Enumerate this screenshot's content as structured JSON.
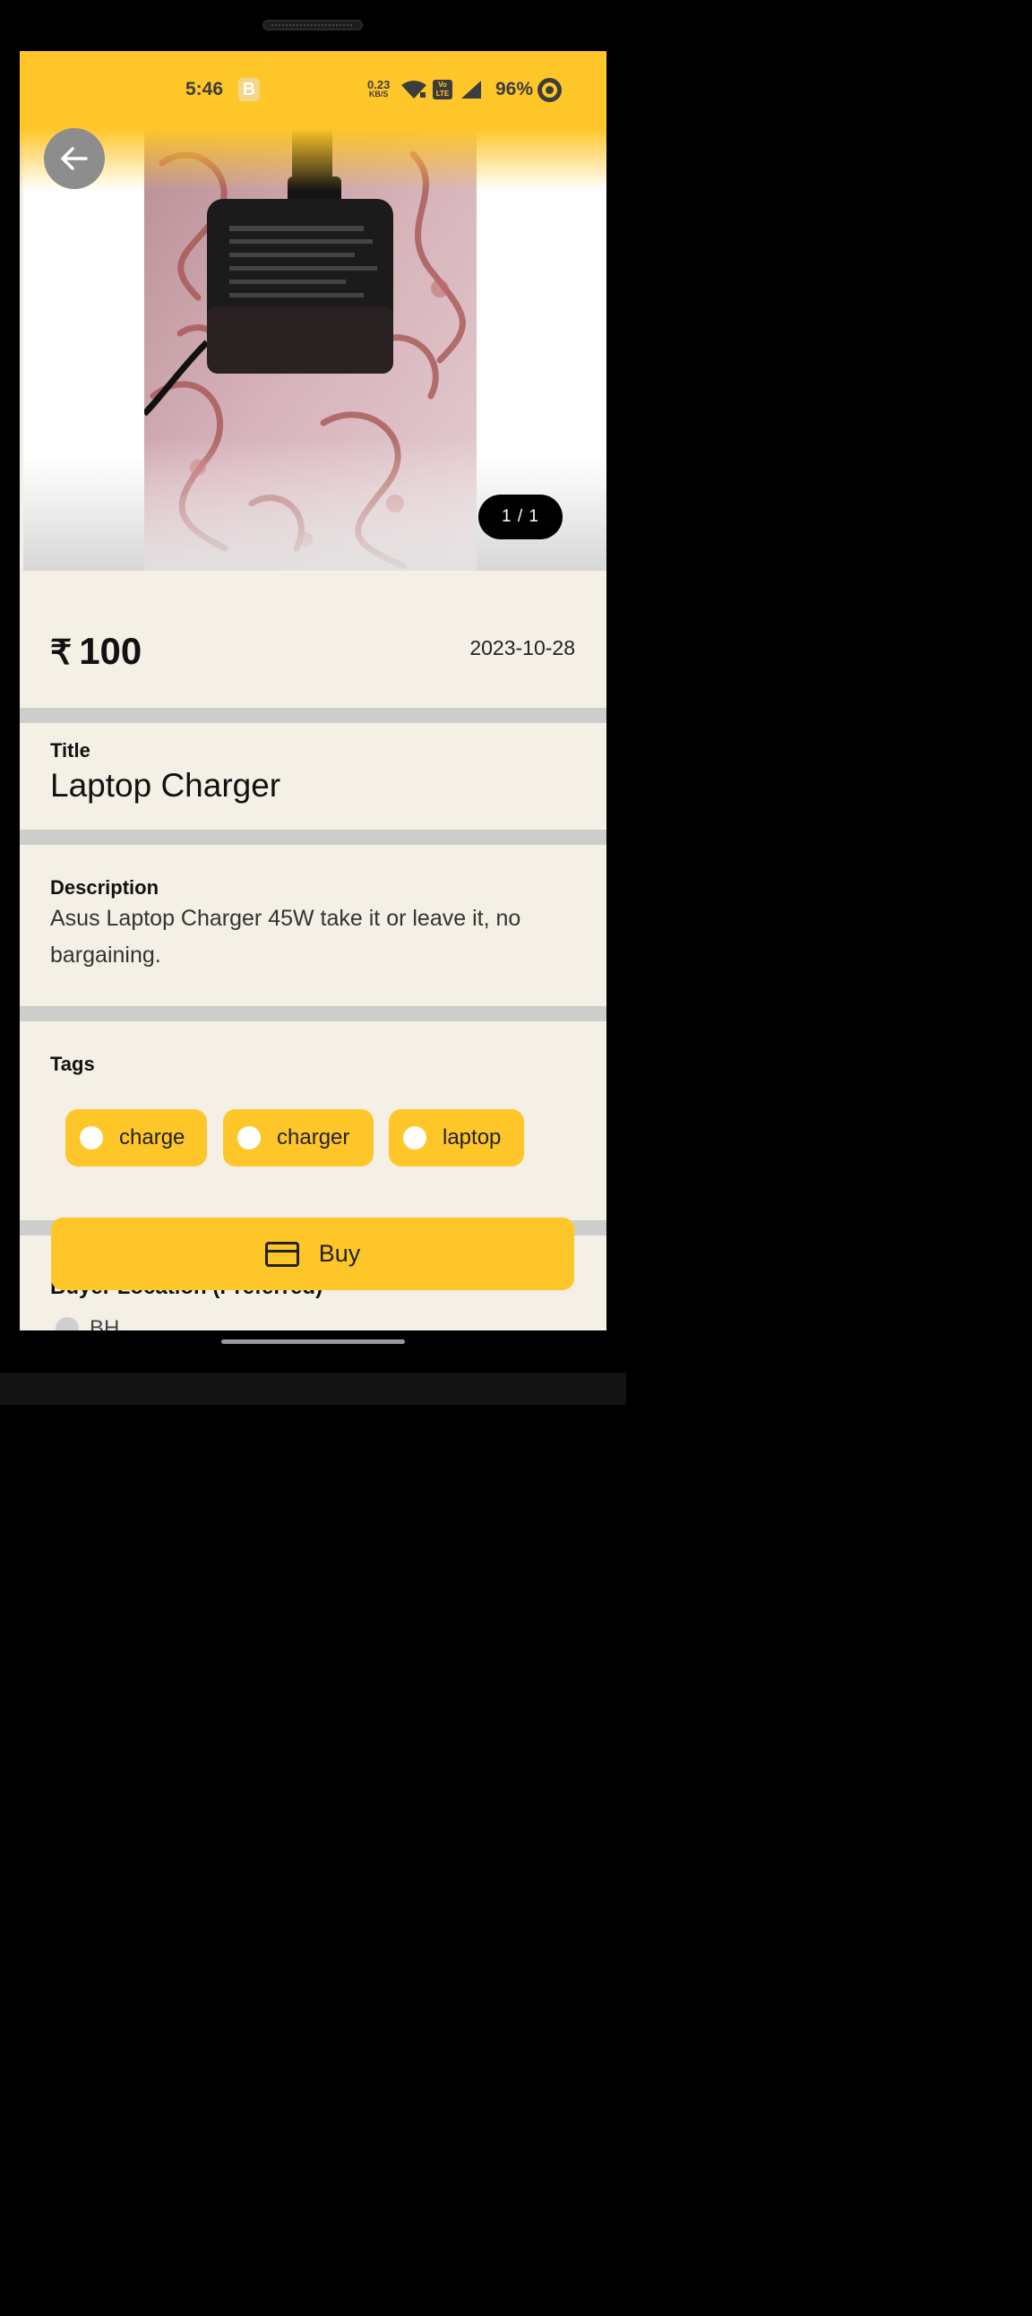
{
  "status_bar": {
    "time": "5:46",
    "app_badge": "B",
    "speed_value": "0.23",
    "speed_unit": "KB/S",
    "volte_top": "Vo",
    "volte_bottom": "LTE",
    "battery": "96%"
  },
  "gallery": {
    "counter": "1 / 1"
  },
  "listing": {
    "currency_symbol": "₹",
    "price": "100",
    "date": "2023-10-28",
    "title_label": "Title",
    "title": "Laptop Charger",
    "description_label": "Description",
    "description": "Asus Laptop Charger 45W take it or leave it, no bargaining.",
    "tags_label": "Tags",
    "tags": [
      "charge",
      "charger",
      "laptop"
    ],
    "location_label": "Buyer Location (Preferred)",
    "location_value": "BH"
  },
  "actions": {
    "buy_label": "Buy"
  },
  "colors": {
    "accent": "#ffc629",
    "background": "#f4f0e6",
    "divider": "#cdcdcb"
  }
}
